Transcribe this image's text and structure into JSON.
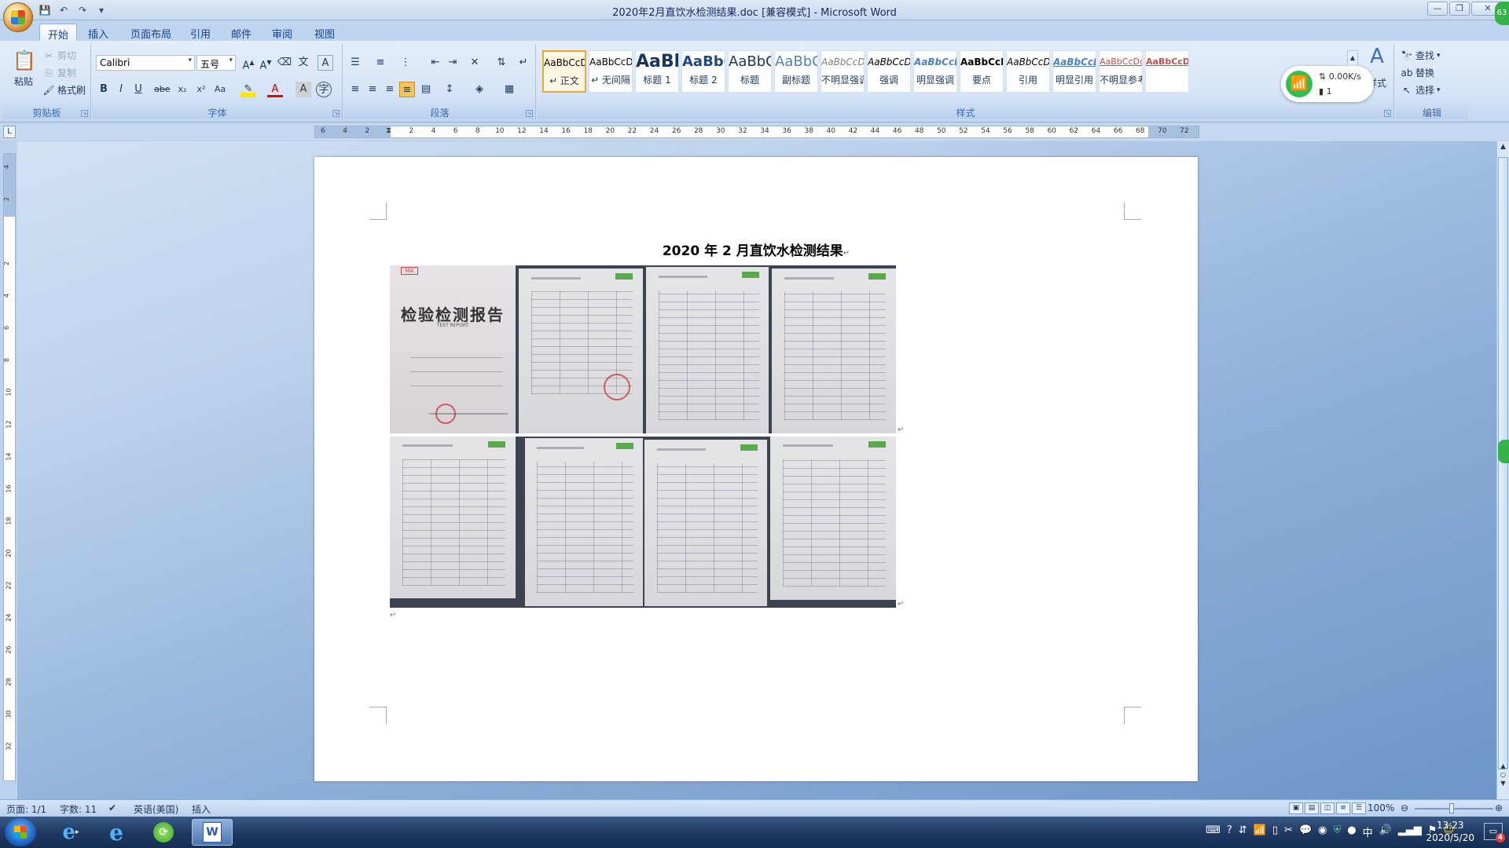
{
  "window": {
    "title": "2020年2月直饮水检测结果.doc [兼容模式] - Microsoft Word",
    "controls": [
      "—",
      "❐",
      "✕"
    ]
  },
  "tabs": [
    "开始",
    "插入",
    "页面布局",
    "引用",
    "邮件",
    "审阅",
    "视图"
  ],
  "clipboard": {
    "paste": "粘贴",
    "cut": "剪切",
    "copy": "复制",
    "format_painter": "格式刷",
    "label": "剪贴板"
  },
  "font": {
    "name": "Calibri",
    "size": "五号",
    "label": "字体",
    "bold": "B",
    "italic": "I",
    "underline": "U",
    "strike": "abe",
    "subscript": "x₂",
    "superscript": "x²",
    "change_case": "Aa"
  },
  "paragraph": {
    "label": "段落"
  },
  "styles": {
    "label": "样式",
    "items": [
      {
        "sample": "AaBbCcDd",
        "name": "↵ 正文",
        "selected": true
      },
      {
        "sample": "AaBbCcDd",
        "name": "↵ 无间隔"
      },
      {
        "sample": "AaBb",
        "name": "标题 1"
      },
      {
        "sample": "AaBbC",
        "name": "标题 2"
      },
      {
        "sample": "AaBbC",
        "name": "标题"
      },
      {
        "sample": "AaBbC",
        "name": "副标题"
      },
      {
        "sample": "AaBbCcDd",
        "name": "不明显强调"
      },
      {
        "sample": "AaBbCcDd",
        "name": "强调"
      },
      {
        "sample": "AaBbCcDd",
        "name": "明显强调"
      },
      {
        "sample": "AaBbCcDd",
        "name": "要点"
      },
      {
        "sample": "AaBbCcDd",
        "name": "引用"
      },
      {
        "sample": "AaBbCcDd",
        "name": "明显引用"
      },
      {
        "sample": "AaBbCcDd",
        "name": "不明显参考"
      },
      {
        "sample": "AaBbCcDd",
        "name": ""
      }
    ],
    "change_styles": "样式"
  },
  "editing": {
    "label": "编辑",
    "find": "查找",
    "replace": "替换",
    "select": "选择"
  },
  "wifi_popup": {
    "speed": "0.00K/s",
    "count": "1"
  },
  "ruler_ticks": [
    "6",
    "4",
    "2",
    "",
    "2",
    "4",
    "6",
    "8",
    "10",
    "12",
    "14",
    "16",
    "18",
    "20",
    "22",
    "24",
    "26",
    "28",
    "30",
    "32",
    "34",
    "36",
    "38",
    "40",
    "42",
    "44",
    "46",
    "48",
    "50",
    "52",
    "54",
    "56",
    "58",
    "60",
    "62",
    "64",
    "66",
    "68",
    "70",
    "72"
  ],
  "vruler_ticks": [
    "4",
    "2",
    "",
    "2",
    "4",
    "6",
    "8",
    "10",
    "12",
    "14",
    "16",
    "18",
    "20",
    "22",
    "24",
    "26",
    "28",
    "30",
    "32"
  ],
  "document": {
    "title": "2020 年 2 月直饮水检测结果",
    "cover_title": "检验检测报告",
    "cover_subtitle": "TEST REPORT"
  },
  "status": {
    "page": "页面: 1/1",
    "words": "字数: 11",
    "language": "英语(美国)",
    "mode": "插入",
    "zoom": "100%"
  },
  "taskbar": {
    "time": "13:23",
    "date": "2020/5/20",
    "notifications": "4"
  }
}
